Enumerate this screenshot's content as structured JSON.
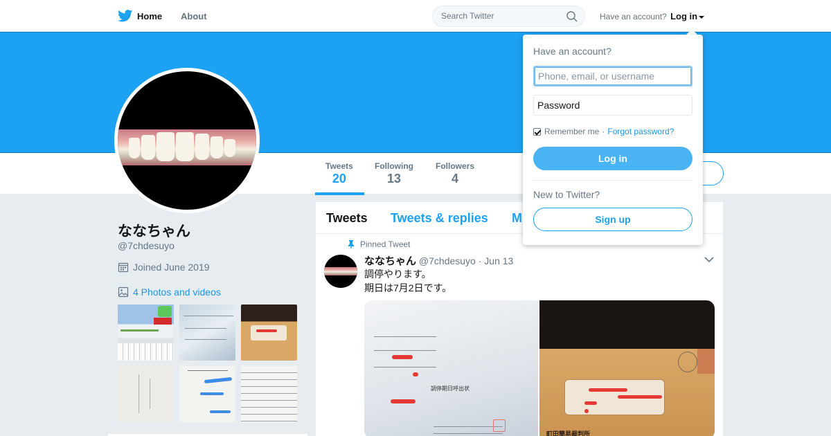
{
  "nav": {
    "home_label": "Home",
    "about_label": "About",
    "search_placeholder": "Search Twitter",
    "have_account_text": "Have an account?",
    "login_label": "Log in"
  },
  "colors": {
    "brand": "#1da1f2",
    "banner": "#1da1f2",
    "link": "#1b95e0"
  },
  "profile": {
    "name": "ななちゃん",
    "handle": "@7chdesuyo",
    "joined": "Joined June 2019",
    "photos_link": "4 Photos and videos"
  },
  "stats": [
    {
      "label": "Tweets",
      "value": "20"
    },
    {
      "label": "Following",
      "value": "13"
    },
    {
      "label": "Followers",
      "value": "4"
    }
  ],
  "timeline": {
    "tabs": [
      "Tweets",
      "Tweets & replies",
      "M"
    ],
    "pinned_label": "Pinned Tweet",
    "tweet": {
      "name": "ななちゃん",
      "handle": "@7chdesuyo",
      "date": "· Jun 13",
      "text_line1": "調停やります。",
      "text_line2": "期日は7月2日です。"
    }
  },
  "login_dropdown": {
    "title": "Have an account?",
    "username_placeholder": "Phone, email, or username",
    "password_placeholder": "Password",
    "remember_label": "Remember me",
    "forgot_label": "Forgot password?",
    "login_button": "Log in",
    "new_text": "New to Twitter?",
    "signup_button": "Sign up"
  },
  "media_text": {
    "summons_title": "調停期日呼出状",
    "court_label": "町田簡易裁判所"
  },
  "icons": {
    "logo": "twitter-bird-icon",
    "search": "search-icon",
    "calendar": "calendar-icon",
    "photo": "photo-icon",
    "pin": "pin-icon",
    "chevron": "chevron-down-icon"
  }
}
